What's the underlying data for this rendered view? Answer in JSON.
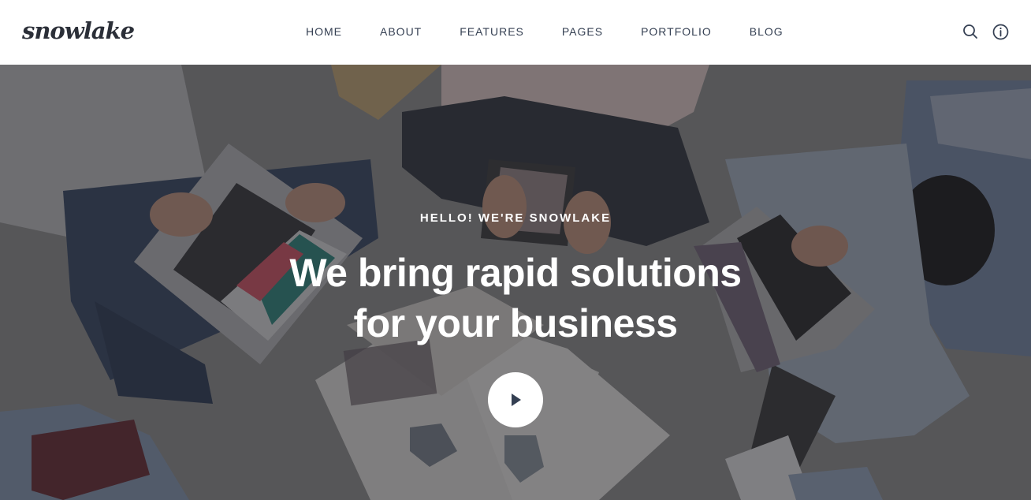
{
  "header": {
    "logo": "snowlake",
    "nav": [
      {
        "label": "HOME"
      },
      {
        "label": "ABOUT"
      },
      {
        "label": "FEATURES"
      },
      {
        "label": "PAGES"
      },
      {
        "label": "PORTFOLIO"
      },
      {
        "label": "BLOG"
      }
    ],
    "icons": [
      "search-icon",
      "info-icon"
    ]
  },
  "hero": {
    "eyebrow": "HELLO! WE'RE SNOWLAKE",
    "headline_line1": "We bring rapid solutions",
    "headline_line2": "for your business",
    "play_icon": "play-icon",
    "background": "photo-people-working-on-laptops"
  },
  "colors": {
    "text_dark": "#343f52",
    "overlay": "#1e1e22",
    "white": "#ffffff"
  }
}
